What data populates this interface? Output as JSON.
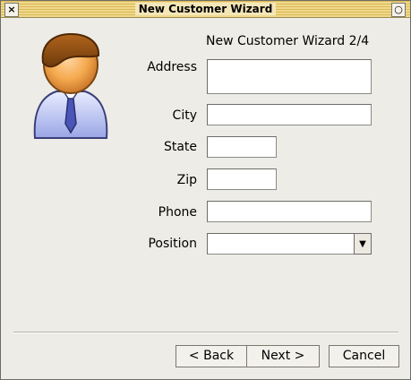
{
  "window": {
    "title": "New Customer Wizard",
    "close_glyph": "×",
    "maximize_glyph": "○"
  },
  "wizard": {
    "heading": "New Customer Wizard 2/4",
    "avatar_icon": "user-avatar-icon"
  },
  "form": {
    "address_label": "Address",
    "address_value": "",
    "city_label": "City",
    "city_value": "",
    "state_label": "State",
    "state_value": "",
    "zip_label": "Zip",
    "zip_value": "",
    "phone_label": "Phone",
    "phone_value": "",
    "position_label": "Position",
    "position_value": "",
    "position_dropdown_glyph": "▼"
  },
  "buttons": {
    "back": "< Back",
    "next": "Next >",
    "cancel": "Cancel"
  }
}
